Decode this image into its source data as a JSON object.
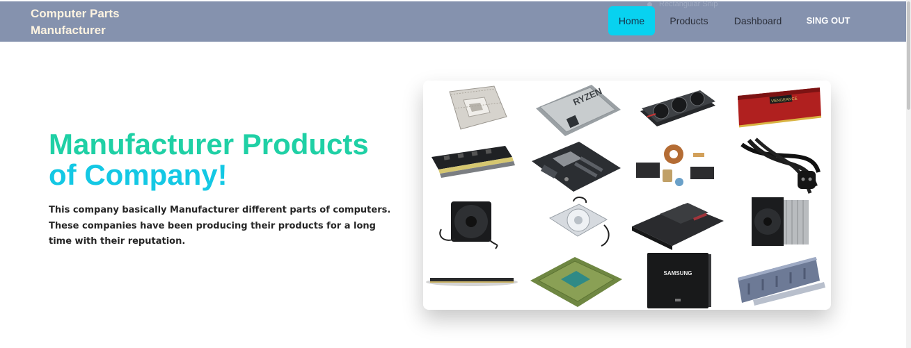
{
  "brand": {
    "line1": "Computer Parts",
    "line2": "Manufacturer"
  },
  "ghost_tooltip": "Rectangular Snip",
  "nav": {
    "home": "Home",
    "products": "Products",
    "dashboard": "Dashboard",
    "signout": "SING OUT"
  },
  "hero": {
    "title_line1": "Manufacturer Products",
    "title_line2": "of Company!",
    "description": "This company basically Manufacturer different parts of computers. These companies have been producing their products for a long time with their reputation."
  },
  "gallery": {
    "items": [
      {
        "icon": "cpu-socket-icon"
      },
      {
        "icon": "ryzen-cpu-icon",
        "label": "RYZEN"
      },
      {
        "icon": "graphics-card-icon"
      },
      {
        "icon": "ram-red-icon",
        "label": "VENGEANCE"
      },
      {
        "icon": "ram-stick-icon"
      },
      {
        "icon": "motherboard-icon"
      },
      {
        "icon": "electronic-components-icon"
      },
      {
        "icon": "power-cable-icon"
      },
      {
        "icon": "case-fan-icon"
      },
      {
        "icon": "clear-fan-icon"
      },
      {
        "icon": "ssd-drive-icon"
      },
      {
        "icon": "cpu-cooler-icon"
      },
      {
        "icon": "thin-ram-icon"
      },
      {
        "icon": "processor-chip-icon"
      },
      {
        "icon": "samsung-ssd-icon",
        "label": "SAMSUNG"
      },
      {
        "icon": "memory-module-icon"
      }
    ]
  },
  "colors": {
    "navbar": "#8592ae",
    "active_tab": "#08d2f0",
    "title_green": "#1fd0a5",
    "title_cyan": "#14c8e4"
  }
}
